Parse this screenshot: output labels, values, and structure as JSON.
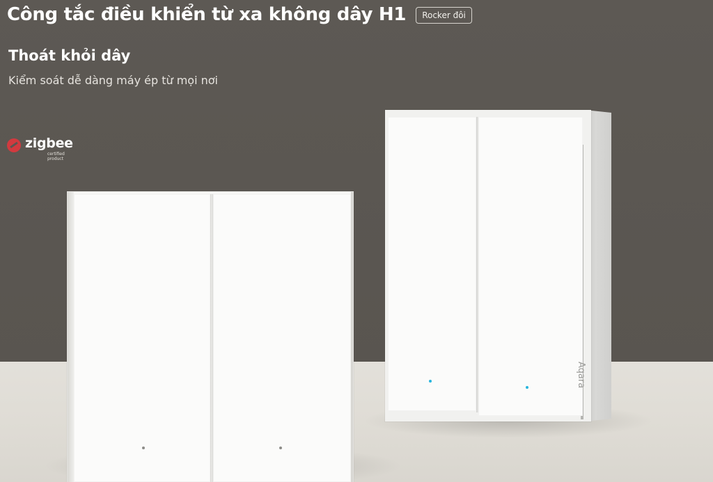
{
  "header": {
    "title": "Công tắc điều khiển từ xa không dây H1",
    "variant_badge": "Rocker đôi",
    "subtitle": "Thoát khỏi dây",
    "tagline": "Kiểm soát dễ dàng máy ép từ mọi nơi"
  },
  "certification": {
    "logo_word": "zigbee",
    "logo_caption": "certified product",
    "logo_color": "#d23a3f"
  },
  "product": {
    "brand_mark": "Aqara",
    "led_color": "#27b5de",
    "panel_color": "#f7f7f5",
    "background_color": "#5c5853"
  }
}
